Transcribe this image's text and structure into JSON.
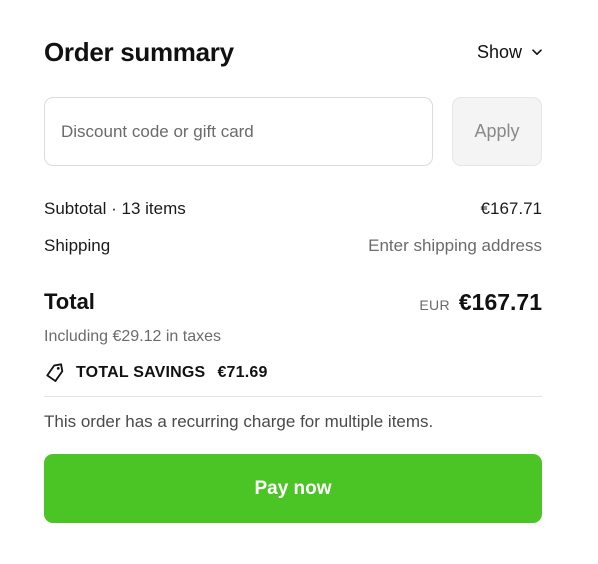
{
  "header": {
    "title": "Order summary",
    "toggle_label": "Show"
  },
  "discount": {
    "placeholder": "Discount code or gift card",
    "value": "",
    "apply_label": "Apply"
  },
  "lines": {
    "subtotal_label": "Subtotal · 13 items",
    "subtotal_value": "€167.71",
    "shipping_label": "Shipping",
    "shipping_value": "Enter shipping address"
  },
  "total": {
    "label": "Total",
    "currency": "EUR",
    "value": "€167.71",
    "taxes_note": "Including €29.12 in taxes"
  },
  "savings": {
    "label": "TOTAL SAVINGS",
    "amount": "€71.69",
    "icon": "tag-icon"
  },
  "recurring_note": "This order has a recurring charge for multiple items.",
  "pay_button": {
    "label": "Pay now",
    "color": "#4bc425"
  }
}
